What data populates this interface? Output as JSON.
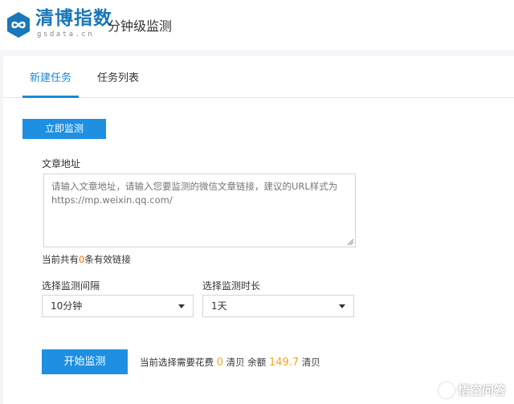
{
  "header": {
    "logo_title": "清博指数",
    "logo_sub": "gsdata.cn",
    "page_title": "分钟级监测",
    "brand_color": "#1a77b9"
  },
  "tabs": [
    {
      "label": "新建任务",
      "active": true
    },
    {
      "label": "任务列表",
      "active": false
    }
  ],
  "actions": {
    "monitor_now_label": "立即监测",
    "start_label": "开始监测"
  },
  "form": {
    "url_label": "文章地址",
    "url_placeholder": "请输入文章地址，请输入您要监测的微信文章链接，建议的URL样式为https://mp.weixin.qq.com/",
    "url_value": "",
    "count_prefix": "当前共有",
    "count_value": "0",
    "count_suffix": "条有效链接",
    "interval_label": "选择监测间隔",
    "interval_selected": "10分钟",
    "duration_label": "选择监测时长",
    "duration_selected": "1天"
  },
  "cost": {
    "prefix": "当前选择需要花费",
    "cost_value": "0",
    "unit1": "清贝",
    "balance_label": "余额",
    "balance_value": "149.7",
    "unit2": "清贝"
  },
  "watermark": {
    "text": "悟空问答",
    "icon": "wukong-logo-icon"
  },
  "colors": {
    "accent": "#1e8fe1",
    "highlight_orange": "#ff6a00",
    "balance_orange": "#f5a623"
  }
}
